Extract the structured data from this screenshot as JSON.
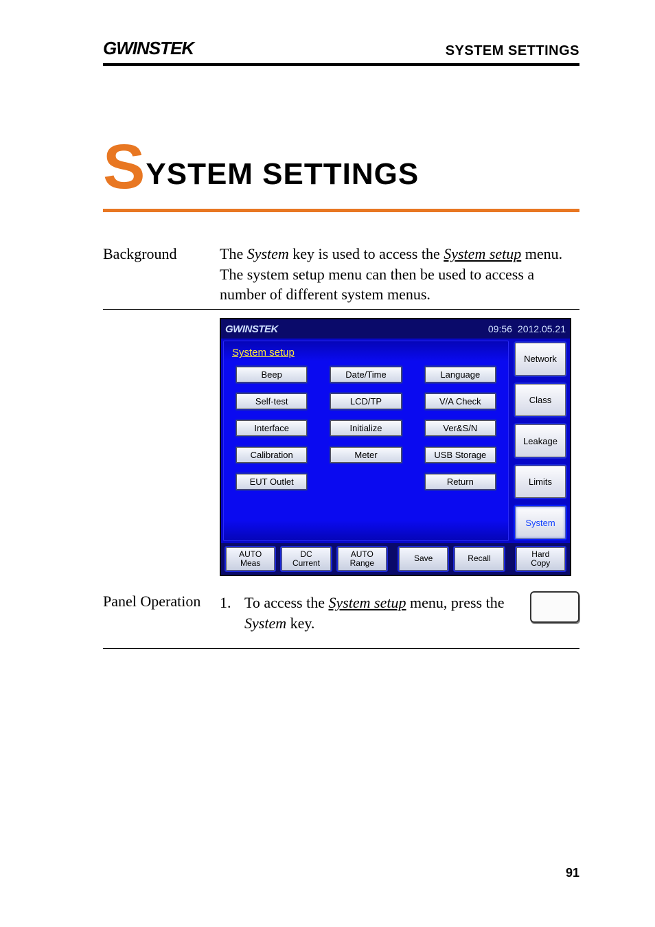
{
  "header": {
    "brand": "GWINSTEK",
    "section": "SYSTEM SETTINGS"
  },
  "chapter": {
    "initial": "S",
    "rest": "YSTEM SETTINGS"
  },
  "background": {
    "label": "Background",
    "text_pre": "The ",
    "key": "System",
    "text_mid": " key is used to access the ",
    "menu": "System setup",
    "text_post": " menu. The system setup menu can then be used to access a number of different system menus."
  },
  "screenshot": {
    "brand": "GWINSTEK",
    "time": "09:56",
    "date": "2012.05.21",
    "title": "System setup",
    "grid": [
      [
        "Beep",
        "Date/Time",
        "Language"
      ],
      [
        "Self-test",
        "LCD/TP",
        "V/A Check"
      ],
      [
        "Interface",
        "Initialize",
        "Ver&S/N"
      ],
      [
        "Calibration",
        "Meter",
        "USB Storage"
      ],
      [
        "EUT Outlet",
        "",
        "Return"
      ]
    ],
    "side": [
      "Network",
      "Class",
      "Leakage",
      "Limits",
      "System"
    ],
    "side_active_index": 4,
    "footer": [
      {
        "l1": "AUTO",
        "l2": "Meas"
      },
      {
        "l1": "DC",
        "l2": "Current"
      },
      {
        "l1": "AUTO",
        "l2": "Range"
      },
      {
        "l1": "Save",
        "l2": ""
      },
      {
        "l1": "Recall",
        "l2": ""
      },
      {
        "l1": "Hard",
        "l2": "Copy"
      }
    ]
  },
  "operation": {
    "label": "Panel Operation",
    "num": "1.",
    "text_pre": "To access the ",
    "menu": "System setup",
    "text_mid": " menu, press the ",
    "key": "System",
    "text_post": " key."
  },
  "page_number": "91"
}
